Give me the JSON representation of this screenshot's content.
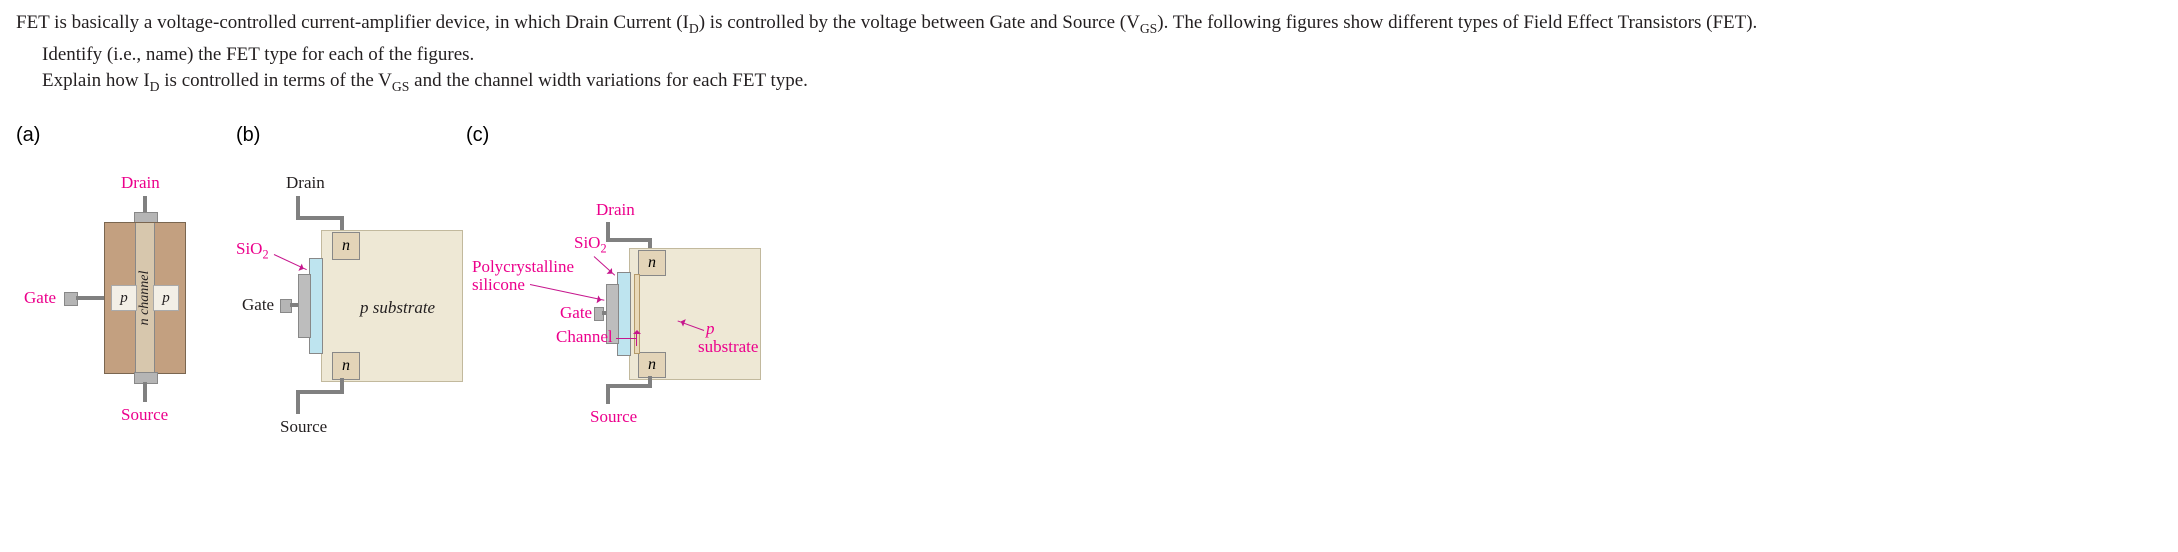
{
  "question": {
    "intro": "FET is basically a voltage-controlled current-amplifier device, in which Drain Current (I",
    "intro_sub1": "D",
    "intro_mid": ") is controlled by the voltage between Gate and Source (V",
    "intro_sub2": "GS",
    "intro_end": "). The following figures show different types of Field Effect Transistors (FET).",
    "task1": "Identify (i.e., name) the FET type for each of the figures.",
    "task2_a": "Explain how I",
    "task2_sub1": "D",
    "task2_b": " is controlled in terms of the V",
    "task2_sub2": "GS",
    "task2_c": " and the channel width variations for each FET type."
  },
  "fig_a": {
    "label": "(a)",
    "drain": "Drain",
    "source": "Source",
    "gate": "Gate",
    "p_left": "p",
    "p_right": "p",
    "channel": "n channel"
  },
  "fig_b": {
    "label": "(b)",
    "drain": "Drain",
    "source": "Source",
    "gate": "Gate",
    "sio2": "SiO",
    "sio2_sub": "2",
    "n_top": "n",
    "n_bot": "n",
    "substrate": "p substrate"
  },
  "fig_c": {
    "label": "(c)",
    "drain": "Drain",
    "source": "Source",
    "gate": "Gate",
    "sio2": "SiO",
    "sio2_sub": "2",
    "poly_l1": "Polycrystalline",
    "poly_l2": "silicone",
    "channel": "Channel",
    "n_top": "n",
    "n_bot": "n",
    "sub_a": "p",
    "sub_b": "substrate"
  }
}
